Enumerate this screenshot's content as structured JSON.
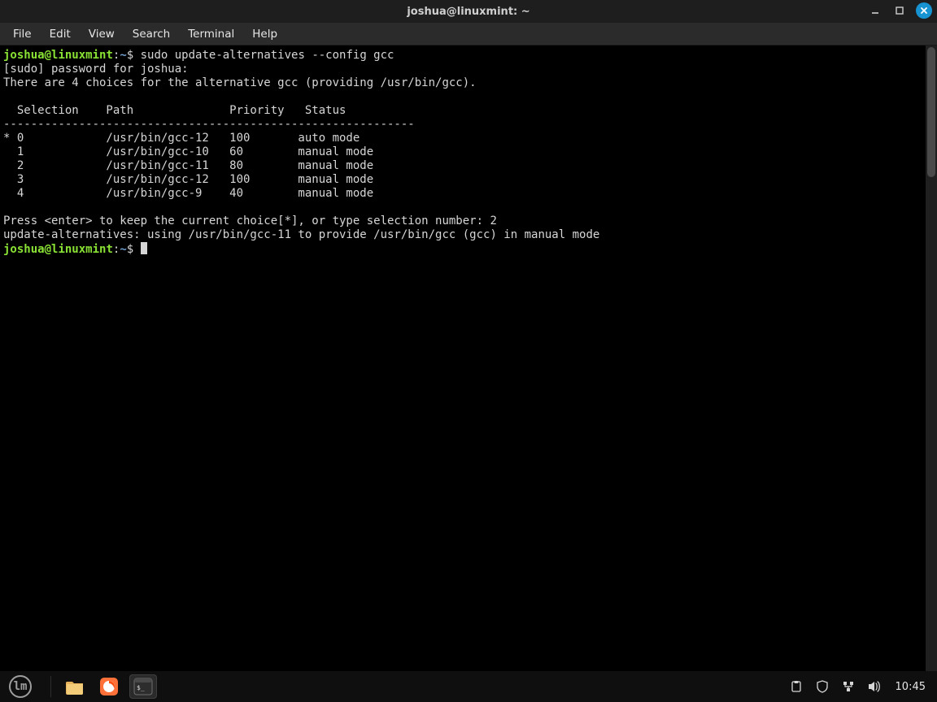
{
  "titlebar": {
    "title": "joshua@linuxmint: ~"
  },
  "menu": {
    "file": "File",
    "edit": "Edit",
    "view": "View",
    "search": "Search",
    "terminal": "Terminal",
    "help": "Help"
  },
  "colors": {
    "prompt_user": "#8ae234",
    "prompt_path": "#729fcf",
    "close_btn": "#1793d1"
  },
  "terminal": {
    "user": "joshua",
    "host": "linuxmint",
    "cwd": "~",
    "command1": "sudo update-alternatives --config gcc",
    "sudo_prompt": "[sudo] password for joshua:",
    "choices_line": "There are 4 choices for the alternative gcc (providing /usr/bin/gcc).",
    "header": "  Selection    Path              Priority   Status",
    "separator": "------------------------------------------------------------",
    "rows": [
      "* 0            /usr/bin/gcc-12   100       auto mode",
      "  1            /usr/bin/gcc-10   60        manual mode",
      "  2            /usr/bin/gcc-11   80        manual mode",
      "  3            /usr/bin/gcc-12   100       manual mode",
      "  4            /usr/bin/gcc-9    40        manual mode"
    ],
    "press_enter": "Press <enter> to keep the current choice[*], or type selection number: 2",
    "result": "update-alternatives: using /usr/bin/gcc-11 to provide /usr/bin/gcc (gcc) in manual mode"
  },
  "taskbar": {
    "clock": "10:45",
    "apps": {
      "files": "files",
      "firefox": "firefox",
      "terminal": "terminal"
    },
    "tray": {
      "clipboard": "clipboard",
      "firewall": "firewall",
      "network": "network",
      "volume": "volume"
    }
  }
}
